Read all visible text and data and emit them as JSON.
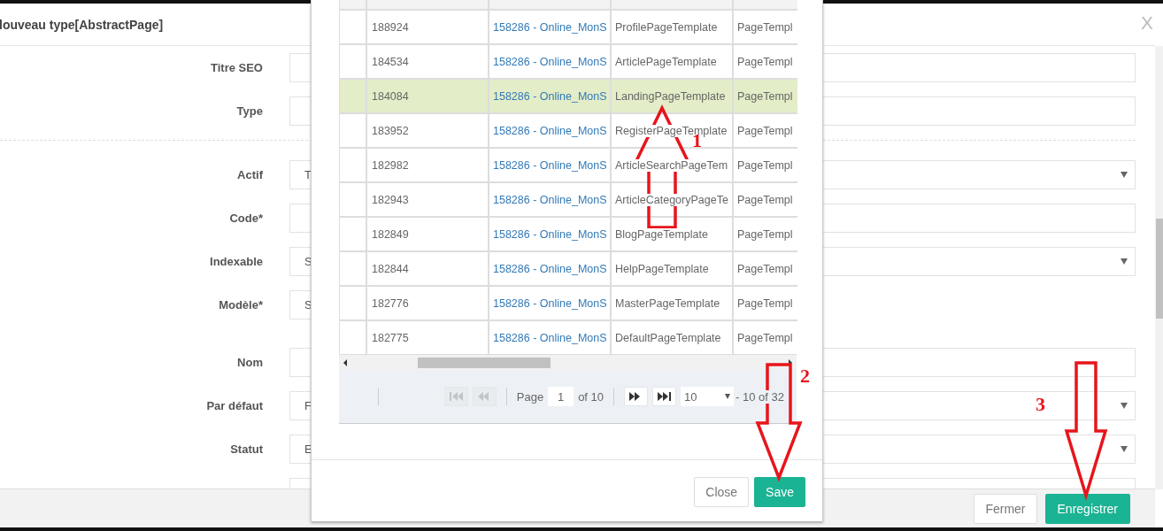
{
  "background_dialog": {
    "title": "louveau type[AbstractPage]",
    "close": "X",
    "fields": [
      {
        "label": "Titre SEO",
        "kind": "text"
      },
      {
        "label": "Type",
        "kind": "text",
        "divider_after": true
      },
      {
        "label": "Actif",
        "kind": "select",
        "value": "T"
      },
      {
        "label": "Code*",
        "kind": "text"
      },
      {
        "label": "Indexable",
        "kind": "select",
        "value": "S"
      },
      {
        "label": "Modèle*",
        "kind": "short",
        "value": "S"
      },
      {
        "label": "Nom",
        "kind": "text"
      },
      {
        "label": "Par défaut",
        "kind": "select",
        "value": "F"
      },
      {
        "label": "Statut",
        "kind": "select",
        "value": "E"
      },
      {
        "kind": "text"
      }
    ],
    "buttons": [
      {
        "label": "Fermer",
        "kind": "secondary"
      },
      {
        "label": "Enregistrer",
        "kind": "primary"
      }
    ]
  },
  "picker_dialog": {
    "rows": [
      {
        "id": "188924",
        "project": "158286 - Online_MonS",
        "template": "ProfilePageTemplate",
        "type": "PageTempl",
        "selected": false
      },
      {
        "id": "184534",
        "project": "158286 - Online_MonS",
        "template": "ArticlePageTemplate",
        "type": "PageTempl",
        "selected": false
      },
      {
        "id": "184084",
        "project": "158286 - Online_MonS",
        "template": "LandingPageTemplate",
        "type": "PageTempl",
        "selected": true
      },
      {
        "id": "183952",
        "project": "158286 - Online_MonS",
        "template": "RegisterPageTemplate",
        "type": "PageTempl",
        "selected": false
      },
      {
        "id": "182982",
        "project": "158286 - Online_MonS",
        "template": "ArticleSearchPageTem",
        "type": "PageTempl",
        "selected": false
      },
      {
        "id": "182943",
        "project": "158286 - Online_MonS",
        "template": "ArticleCategoryPageTe",
        "type": "PageTempl",
        "selected": false
      },
      {
        "id": "182849",
        "project": "158286 - Online_MonS",
        "template": "BlogPageTemplate",
        "type": "PageTempl",
        "selected": false
      },
      {
        "id": "182844",
        "project": "158286 - Online_MonS",
        "template": "HelpPageTemplate",
        "type": "PageTempl",
        "selected": false
      },
      {
        "id": "182776",
        "project": "158286 - Online_MonS",
        "template": "MasterPageTemplate",
        "type": "PageTempl",
        "selected": false
      },
      {
        "id": "182775",
        "project": "158286 - Online_MonS",
        "template": "DefaultPageTemplate",
        "type": "PageTempl",
        "selected": false
      }
    ],
    "pager": {
      "nav": [
        {
          "kind": "first",
          "disabled": true
        },
        {
          "kind": "prev",
          "disabled": true
        },
        {
          "kind": "next",
          "disabled": false
        },
        {
          "kind": "last",
          "disabled": false
        }
      ],
      "page_label": "Page",
      "page": "1",
      "of_pages": "of 10",
      "page_size": "10",
      "range": "- 10 of 32"
    },
    "buttons": [
      {
        "label": "Close",
        "kind": "secondary"
      },
      {
        "label": "Save",
        "kind": "primary"
      }
    ]
  },
  "annotations": [
    {
      "number": "1"
    },
    {
      "number": "2"
    },
    {
      "number": "3"
    }
  ]
}
